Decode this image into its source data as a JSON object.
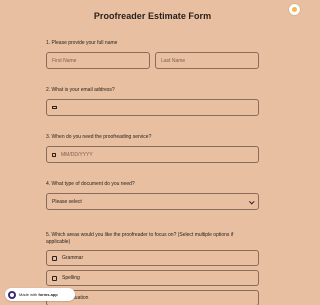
{
  "title": "Proofreader Estimate Form",
  "questions": {
    "q1": {
      "label": "1. Please provide your full name",
      "first_placeholder": "First Name",
      "last_placeholder": "Last Name"
    },
    "q2": {
      "label": "2. What is your email address?"
    },
    "q3": {
      "label": "3. When do you need the proofreading service?",
      "date_placeholder": "MM/DD/YYYY"
    },
    "q4": {
      "label": "4. What type of document do you need?",
      "select_value": "Please select"
    },
    "q5": {
      "label_line1": "5. Which areas would you like the proofreader to focus on? (Select multiple options if",
      "label_line2": "applicable)",
      "options": [
        "Grammar",
        "Spelling",
        "Punctuation"
      ]
    }
  },
  "badge": {
    "prefix": "Made with ",
    "brand": "forms.app"
  },
  "colors": {
    "background": "#e8bfa1",
    "border": "#8b6b5a",
    "text": "#2b211c"
  }
}
